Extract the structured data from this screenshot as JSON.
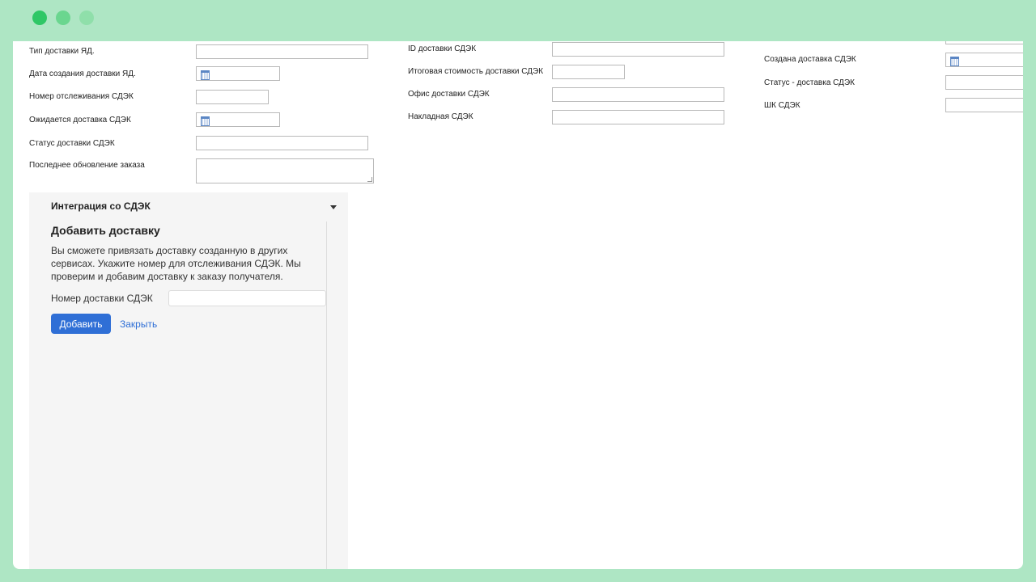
{
  "window_controls": [
    "close",
    "minimize",
    "maximize"
  ],
  "form": {
    "col1": {
      "delivery_type_yd": "Тип доставки ЯД.",
      "delivery_created_date_yd": "Дата создания доставки ЯД.",
      "tracking_number_cdek": "Номер отслеживания СДЭК",
      "expected_delivery_cdek": "Ожидается доставка СДЭК",
      "delivery_status_cdek": "Статус доставки СДЭК",
      "last_order_update": "Последнее обновление заказа"
    },
    "col2": {
      "delivery_id_cdek": "ID доставки СДЭК",
      "total_cost_cdek": "Итоговая стоимость доставки СДЭК",
      "office_cdek": "Офис доставки СДЭК",
      "waybill_cdek": "Накладная СДЭК"
    },
    "col3": {
      "created_delivery_cdek": "Создана доставка СДЭК",
      "status_delivery_cdek": "Статус - доставка СДЭК",
      "barcode_cdek": "ШК СДЭК"
    }
  },
  "integration": {
    "header": "Интеграция со СДЭК",
    "title": "Добавить доставку",
    "description": "Вы сможете привязать доставку созданную в других сервисах. Укажите номер для отслеживания СДЭК. Мы проверим и добавим доставку к заказу получателя.",
    "field_label": "Номер доставки СДЭК",
    "field_value": "",
    "add_button": "Добавить",
    "close_link": "Закрыть"
  }
}
